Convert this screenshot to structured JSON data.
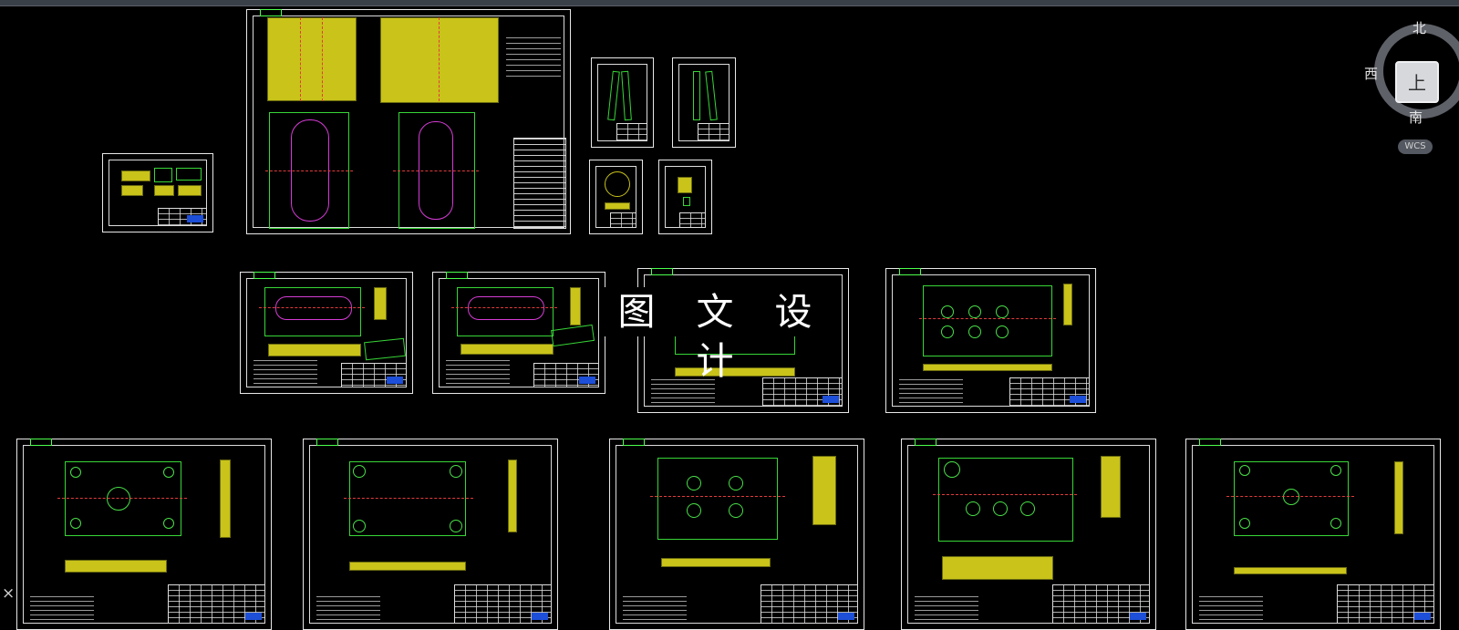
{
  "watermark": "图 文 设 计",
  "viewcube": {
    "north": "北",
    "south": "南",
    "west": "西",
    "face": "上",
    "ucs": "WCS"
  },
  "close_glyph": "×",
  "colors": {
    "background": "#000000",
    "frame": "#e8e8e8",
    "part_fill": "#c9c31a",
    "outline": "#37d637",
    "centerline": "#e23b3b",
    "title_block_accent": "#1d4fd8"
  }
}
